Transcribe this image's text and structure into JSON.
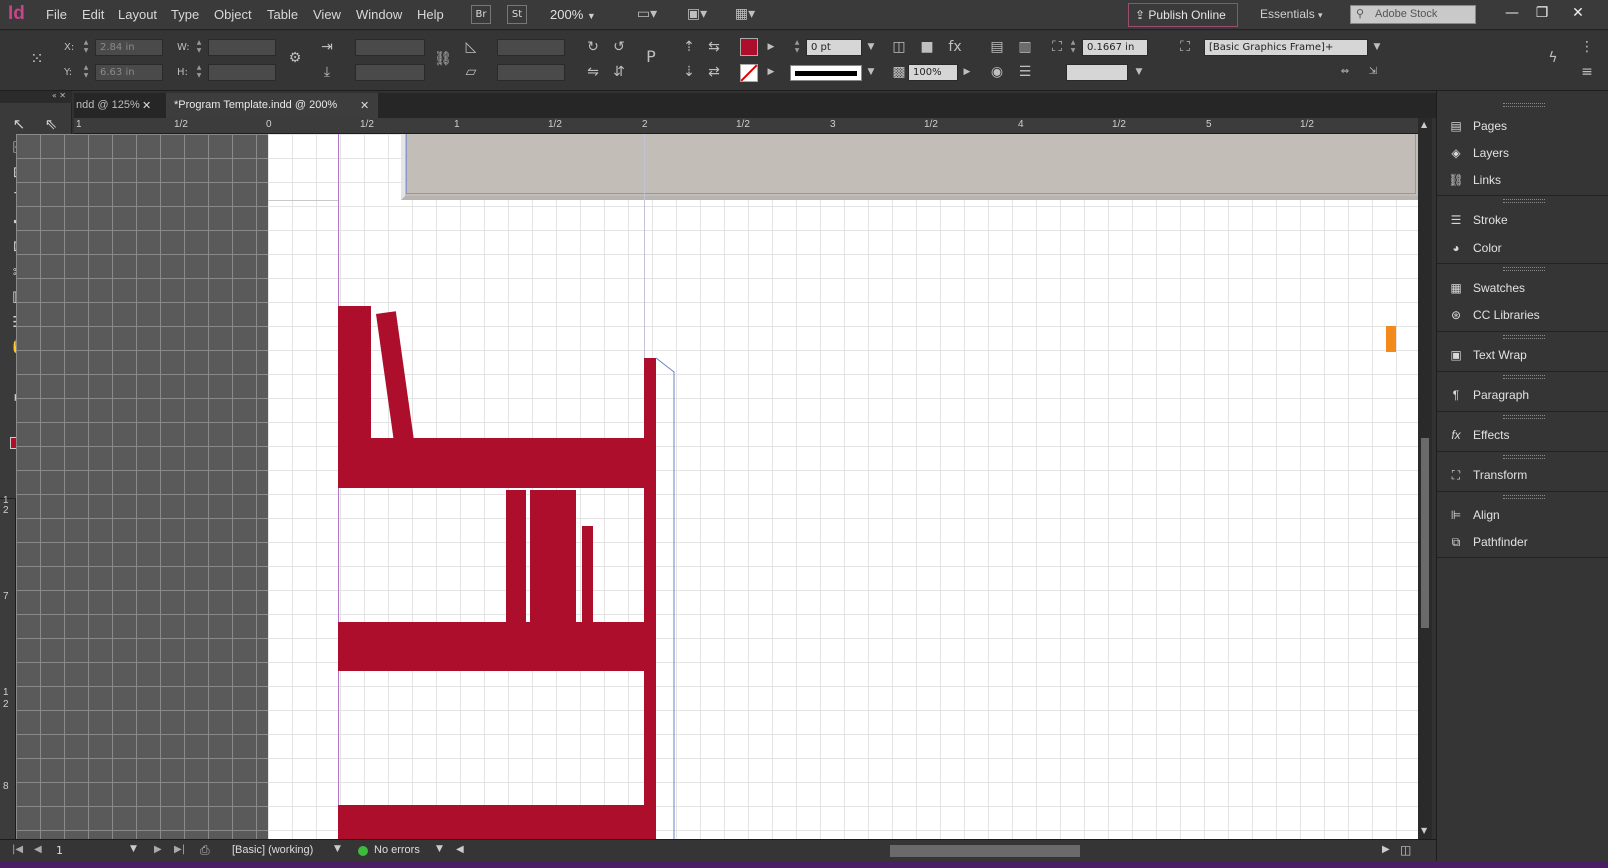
{
  "menubar": {
    "logo": "Id",
    "items": [
      "File",
      "Edit",
      "Layout",
      "Type",
      "Object",
      "Table",
      "View",
      "Window",
      "Help"
    ],
    "bridge_btn": "Br",
    "stock_btn": "St",
    "zoom": "200%",
    "publish_online": "Publish Online",
    "workspace": "Essentials",
    "search_placeholder": "Adobe Stock"
  },
  "control": {
    "x_label": "X:",
    "x_value": "2.84 in",
    "y_label": "Y:",
    "y_value": "6.63 in",
    "w_label": "W:",
    "h_label": "H:",
    "stroke_weight": "0 pt",
    "opacity": "100%",
    "offset": "0.1667 in",
    "object_style": "[Basic Graphics Frame]+"
  },
  "tabs": [
    {
      "label": "ndd @ 125%"
    },
    {
      "label": "*Program Template.indd @ 200%"
    }
  ],
  "ruler": {
    "top_ticks": [
      "1",
      "1/2",
      "0",
      "1/2",
      "1",
      "1/2",
      "2",
      "1/2",
      "3",
      "1/2",
      "4",
      "1/2",
      "5",
      "1/2"
    ],
    "left_ticks": [
      "1",
      "2",
      "7",
      "1",
      "2",
      "8"
    ]
  },
  "status": {
    "page": "1",
    "style": "[Basic] (working)",
    "preflight": "No errors"
  },
  "panels": [
    {
      "label": "Pages",
      "icon": "pages-icon"
    },
    {
      "label": "Layers",
      "icon": "layers-icon"
    },
    {
      "label": "Links",
      "icon": "links-icon"
    },
    {
      "label": "Stroke",
      "icon": "stroke-icon"
    },
    {
      "label": "Color",
      "icon": "color-icon"
    },
    {
      "label": "Swatches",
      "icon": "swatches-icon"
    },
    {
      "label": "CC Libraries",
      "icon": "cc-libraries-icon"
    },
    {
      "label": "Text Wrap",
      "icon": "text-wrap-icon"
    },
    {
      "label": "Paragraph",
      "icon": "paragraph-icon"
    },
    {
      "label": "Effects",
      "icon": "effects-icon"
    },
    {
      "label": "Transform",
      "icon": "transform-icon"
    },
    {
      "label": "Align",
      "icon": "align-icon"
    },
    {
      "label": "Pathfinder",
      "icon": "pathfinder-icon"
    }
  ],
  "colors": {
    "fill": "#ac0e2c",
    "accent": "#c64488"
  }
}
